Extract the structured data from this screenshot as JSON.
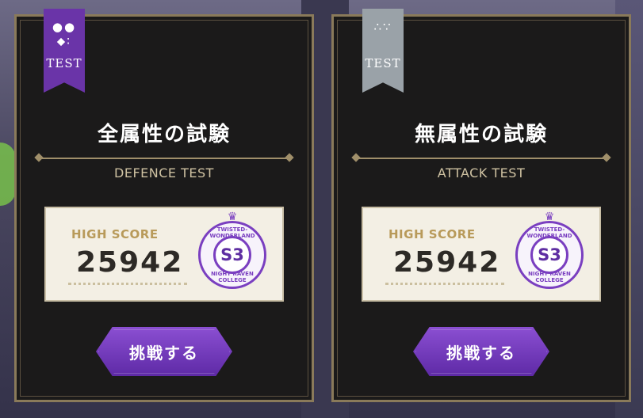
{
  "cards": [
    {
      "ribbon_icon": "●● ⬥∶",
      "ribbon_label": "TEST",
      "title": "全属性の試験",
      "subtitle": "DEFENCE TEST",
      "high_score_label": "HIGH SCORE",
      "score": "25942",
      "rank": "S3",
      "badge_top": "TWISTED-WONDERLAND",
      "badge_bottom": "NIGHT RAVEN COLLEGE",
      "button_label": "挑戦する"
    },
    {
      "ribbon_icon": "∴∵",
      "ribbon_label": "TEST",
      "title": "無属性の試験",
      "subtitle": "ATTACK TEST",
      "high_score_label": "HIGH SCORE",
      "score": "25942",
      "rank": "S3",
      "badge_top": "TWISTED-WONDERLAND",
      "badge_bottom": "NIGHT RAVEN COLLEGE",
      "button_label": "挑戦する"
    }
  ],
  "colors": {
    "panel_bg": "#1b1a1a",
    "gold": "#a08f6a",
    "purple": "#6a34a8",
    "silver": "#9aa2a8"
  }
}
